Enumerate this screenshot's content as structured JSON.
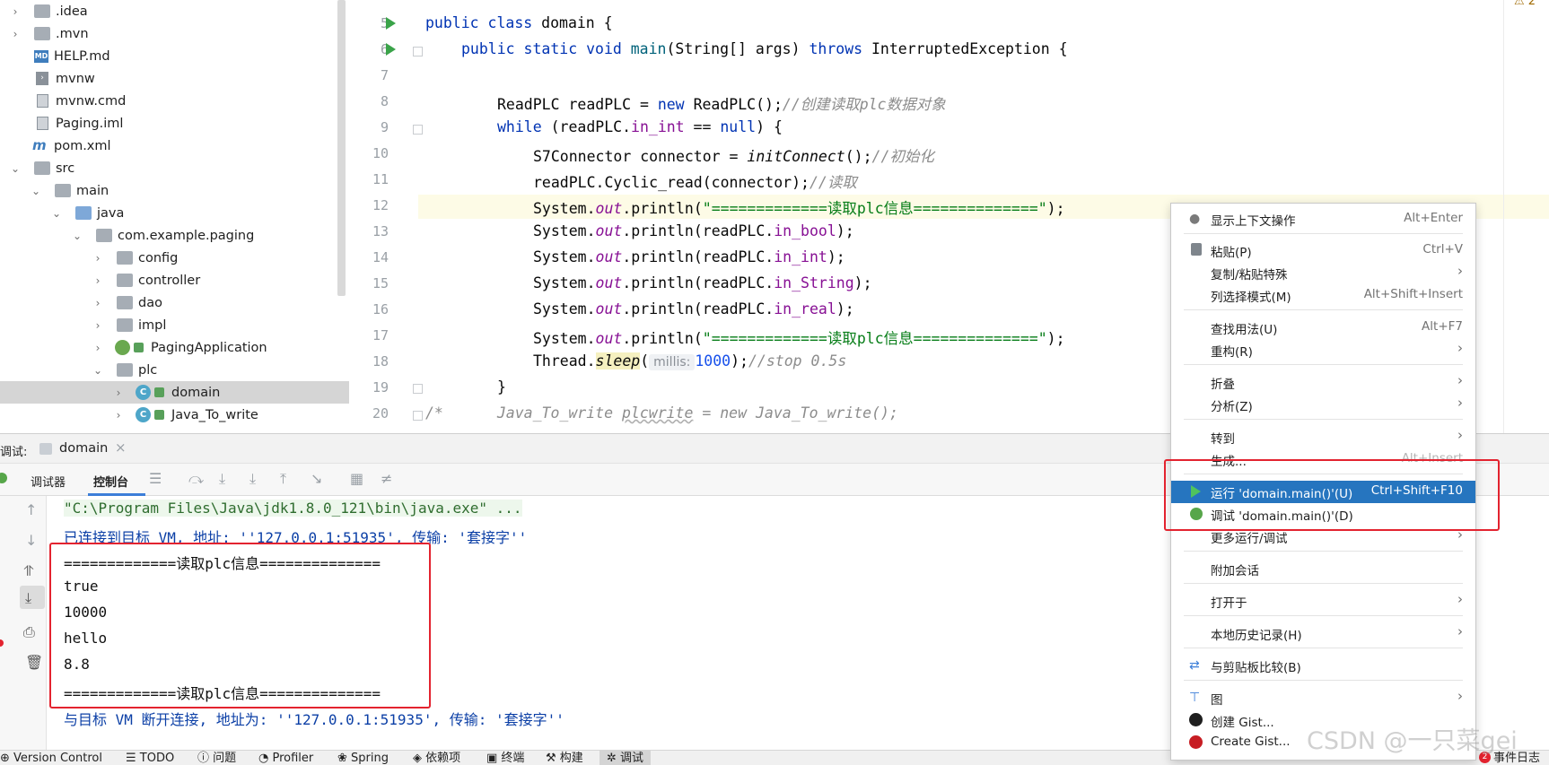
{
  "project_tree": {
    "items": [
      {
        "label": ".idea",
        "icon": "folder-icon"
      },
      {
        "label": ".mvn",
        "icon": "folder-icon"
      },
      {
        "label": "HELP.md",
        "icon": "markdown-file-icon"
      },
      {
        "label": "mvnw",
        "icon": "shell-script-icon"
      },
      {
        "label": "mvnw.cmd",
        "icon": "text-file-icon"
      },
      {
        "label": "Paging.iml",
        "icon": "module-file-icon"
      },
      {
        "label": "pom.xml",
        "icon": "maven-icon"
      },
      {
        "label": "src",
        "icon": "folder-icon"
      },
      {
        "label": "main",
        "icon": "folder-icon"
      },
      {
        "label": "java",
        "icon": "source-folder-icon"
      },
      {
        "label": "com.example.paging",
        "icon": "package-icon"
      },
      {
        "label": "config",
        "icon": "folder-icon"
      },
      {
        "label": "controller",
        "icon": "folder-icon"
      },
      {
        "label": "dao",
        "icon": "folder-icon"
      },
      {
        "label": "impl",
        "icon": "folder-icon"
      },
      {
        "label": "PagingApplication",
        "icon": "spring-class-icon"
      },
      {
        "label": "plc",
        "icon": "folder-icon"
      },
      {
        "label": "domain",
        "icon": "class-icon"
      },
      {
        "label": "Java_To_write",
        "icon": "class-icon"
      }
    ]
  },
  "editor": {
    "line_numbers": [
      "5",
      "6",
      "7",
      "8",
      "9",
      "10",
      "11",
      "12",
      "13",
      "14",
      "15",
      "16",
      "17",
      "18",
      "19",
      "20"
    ],
    "lines": {
      "l5_a": "public class ",
      "l5_b": "domain {",
      "l6_a": "public static void ",
      "l6_b": "main",
      "l6_c": "(String[] args) ",
      "l6_d": "throws ",
      "l6_e": "InterruptedException {",
      "l8_a": "ReadPLC readPLC = ",
      "l8_b": "new ",
      "l8_c": "ReadPLC();",
      "l8_d": "//创建读取plc数据对象",
      "l9_a": "while ",
      "l9_b": "(readPLC.",
      "l9_c": "in_int",
      "l9_d": " == ",
      "l9_e": "null",
      "l9_f": ") {",
      "l10_a": "S7Connector connector = ",
      "l10_b": "initConnect",
      "l10_c": "();",
      "l10_d": "//初始化",
      "l11_a": "readPLC.Cyclic_read(connector);",
      "l11_b": "//读取",
      "l12_a": "System.",
      "l12_b": "out",
      "l12_c": ".println(",
      "l12_d": "\"=============读取plc信息==============\"",
      "l12_e": ");",
      "l13_a": "System.",
      "l13_b": "out",
      "l13_c": ".println(readPLC.",
      "l13_d": "in_bool",
      "l13_e": ");",
      "l14_a": "System.",
      "l14_b": "out",
      "l14_c": ".println(readPLC.",
      "l14_d": "in_int",
      "l14_e": ");",
      "l15_a": "System.",
      "l15_b": "out",
      "l15_c": ".println(readPLC.",
      "l15_d": "in_String",
      "l15_e": ");",
      "l16_a": "System.",
      "l16_b": "out",
      "l16_c": ".println(readPLC.",
      "l16_d": "in_real",
      "l16_e": ");",
      "l17_a": "System.",
      "l17_b": "out",
      "l17_c": ".println(",
      "l17_d": "\"=============读取plc信息==============\"",
      "l17_e": ");",
      "l18_a": "Thread.",
      "l18_b": "sleep",
      "l18_c": "(",
      "l18_hint": "millis:",
      "l18_d": "1000",
      "l18_e": ");",
      "l18_f": "//stop 0.5s",
      "l19_a": "}",
      "l20_a": "/*",
      "l20_b": "Java_To_write ",
      "l20_c": "plcwrite",
      "l20_d": " = new Java_To_write();"
    },
    "warning_count": "2"
  },
  "debug": {
    "panel_label": "调试:",
    "session_tab": "domain",
    "tabs": [
      "调试器",
      "控制台"
    ],
    "console_lines": [
      "\"C:\\Program Files\\Java\\jdk1.8.0_121\\bin\\java.exe\" ...",
      "已连接到目标 VM, 地址: ''127.0.0.1:51935', 传输: '套接字''",
      "=============读取plc信息==============",
      "true",
      "10000",
      "hello",
      "8.8",
      "=============读取plc信息==============",
      "与目标 VM 断开连接, 地址为: ''127.0.0.1:51935', 传输: '套接字''"
    ]
  },
  "context_menu": {
    "items": [
      {
        "label": "显示上下文操作",
        "shortcut": "Alt+Enter",
        "icon": "lightbulb-icon"
      },
      {
        "label": "粘贴(P)",
        "shortcut": "Ctrl+V",
        "icon": "clipboard-icon"
      },
      {
        "label": "复制/粘贴特殊",
        "submenu": true
      },
      {
        "label": "列选择模式(M)",
        "shortcut": "Alt+Shift+Insert"
      },
      {
        "label": "查找用法(U)",
        "shortcut": "Alt+F7"
      },
      {
        "label": "重构(R)",
        "submenu": true
      },
      {
        "label": "折叠",
        "submenu": true
      },
      {
        "label": "分析(Z)",
        "submenu": true
      },
      {
        "label": "转到",
        "submenu": true
      },
      {
        "label": "生成...",
        "shortcut": "Alt+Insert"
      },
      {
        "label": "运行 'domain.main()'(U)",
        "shortcut": "Ctrl+Shift+F10",
        "icon": "run-icon",
        "highlighted": true
      },
      {
        "label": "调试 'domain.main()'(D)",
        "icon": "debug-bug-icon"
      },
      {
        "label": "更多运行/调试",
        "submenu": true
      },
      {
        "label": "附加会话"
      },
      {
        "label": "打开于",
        "submenu": true
      },
      {
        "label": "本地历史记录(H)",
        "submenu": true
      },
      {
        "label": "与剪贴板比较(B)",
        "icon": "compare-icon"
      },
      {
        "label": "图",
        "submenu": true,
        "icon": "diagram-icon"
      },
      {
        "label": "创建 Gist...",
        "icon": "github-icon"
      },
      {
        "label": "Create Gist...",
        "icon": "gitee-icon"
      }
    ]
  },
  "status_bar": {
    "items": [
      "Version Control",
      "TODO",
      "问题",
      "Profiler",
      "Spring",
      "依赖项",
      "终端",
      "构建",
      "调试"
    ],
    "event_log": "事件日志",
    "event_badge": "2"
  },
  "watermark": "CSDN @一只菜gei",
  "colors": {
    "accent": "#2675bf",
    "annotation_red": "#e3232f",
    "run_green": "#3aa349",
    "keyword_blue": "#0033b3",
    "string_green": "#067d17"
  }
}
